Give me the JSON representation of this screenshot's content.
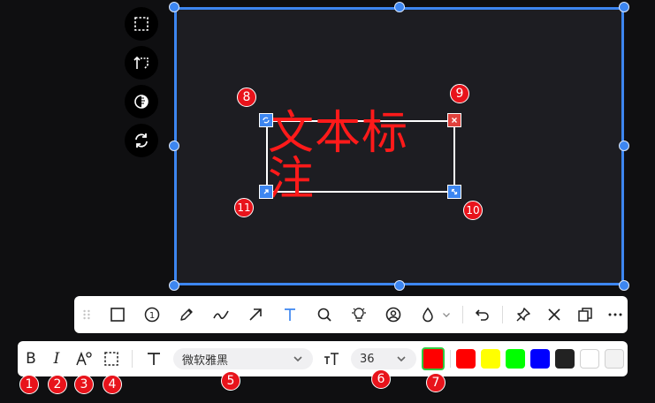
{
  "side_tools": [
    {
      "name": "select-region-icon"
    },
    {
      "name": "flip-icon"
    },
    {
      "name": "contrast-icon"
    },
    {
      "name": "refresh-icon"
    }
  ],
  "annotation": {
    "text": "文本标注",
    "text_color": "#ff1a1a"
  },
  "markers": {
    "m1": "1",
    "m2": "2",
    "m3": "3",
    "m4": "4",
    "m5": "5",
    "m6": "6",
    "m7": "7",
    "m8": "8",
    "m9": "9",
    "m10": "10",
    "m11": "11"
  },
  "toolbar_main": {
    "tools": [
      "drag-handle-icon",
      "rectangle-icon",
      "number-icon",
      "pencil-icon",
      "curve-icon",
      "arrow-icon",
      "text-icon",
      "search-icon",
      "bulb-icon",
      "mask-icon",
      "fill-drop-icon",
      "undo-icon",
      "pin-icon",
      "close-icon",
      "copy-icon",
      "more-icon"
    ],
    "number_glyph": "1",
    "active_tool": "text-icon",
    "active_color": "#3d86f0"
  },
  "text_toolbar": {
    "bold": "B",
    "italic": "I",
    "font_icon": "T",
    "font_family": "微软雅黑",
    "size_icon": "TT",
    "font_size": "36",
    "current_color": "#ff0000",
    "palette": [
      "#ff0000",
      "#ffff00",
      "#00ff00",
      "#0000ff",
      "#222222",
      "#ffffff",
      "#f2f2f2"
    ]
  }
}
